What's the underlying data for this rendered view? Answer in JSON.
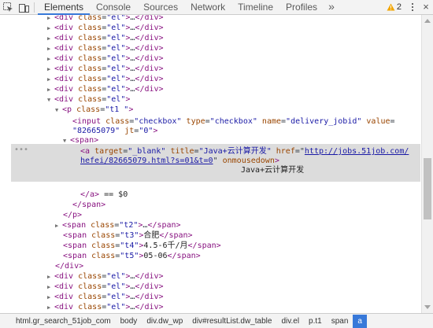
{
  "toolbar": {
    "tabs": [
      "Elements",
      "Console",
      "Sources",
      "Network",
      "Timeline",
      "Profiles"
    ],
    "more": "»",
    "warning_count": "2",
    "close": "×"
  },
  "tree": {
    "collapsed_div": "\"el\"",
    "open_div": "\"el\"",
    "p_class": "\"t1 \"",
    "input_class": "\"checkbox\"",
    "input_type": "\"checkbox\"",
    "input_name": "\"delivery_jobid\"",
    "input_value": "\"82665079\"",
    "input_jt": "\"0\"",
    "a_target": "\"_blank\"",
    "a_title": "\"Java+云计算开发\"",
    "a_href_1": "http://jobs.51job.com/",
    "a_href_2": "hefei/82665079.html?s=01&t=0",
    "a_onmousedown": "onmousedown",
    "a_text": "Java+云计算开发",
    "a_close": "</a>",
    "eq_marker": " == $0",
    "span_t2_class": "\"t2\"",
    "span_t3_class": "\"t3\"",
    "span_t3_text": "合肥",
    "span_t4_class": "\"t4\"",
    "span_t4_text": "4.5-6千/月",
    "span_t5_class": "\"t5\"",
    "span_t5_text": "05-06"
  },
  "breadcrumbs": [
    "html.gr_search_51job_com",
    "body",
    "div.dw_wp",
    "div#resultList.dw_table",
    "div.el",
    "p.t1",
    "span",
    "a"
  ]
}
